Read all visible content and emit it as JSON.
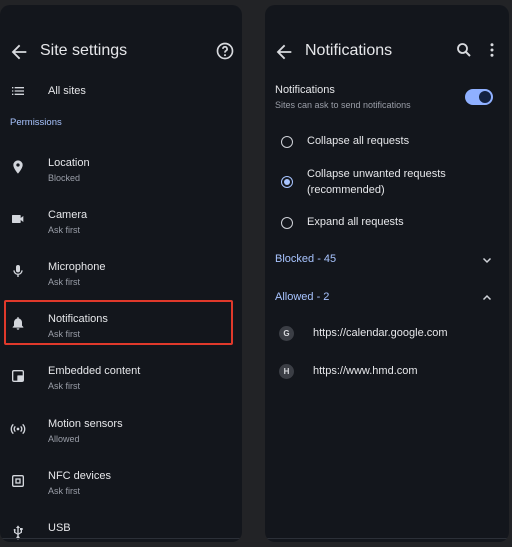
{
  "site_settings": {
    "title": "Site settings",
    "all_sites_label": "All sites",
    "section_label": "Permissions",
    "items": [
      {
        "label": "Location",
        "status": "Blocked"
      },
      {
        "label": "Camera",
        "status": "Ask first"
      },
      {
        "label": "Microphone",
        "status": "Ask first"
      },
      {
        "label": "Notifications",
        "status": "Ask first"
      },
      {
        "label": "Embedded content",
        "status": "Ask first"
      },
      {
        "label": "Motion sensors",
        "status": "Allowed"
      },
      {
        "label": "NFC devices",
        "status": "Ask first"
      },
      {
        "label": "USB",
        "status": ""
      }
    ]
  },
  "notifications": {
    "title": "Notifications",
    "toggle_label": "Notifications",
    "toggle_sub": "Sites can ask to send notifications",
    "toggle_on": true,
    "options": [
      {
        "label": "Collapse all requests",
        "selected": false
      },
      {
        "label": "Collapse unwanted requests (recommended)",
        "selected": true
      },
      {
        "label": "Expand all requests",
        "selected": false
      }
    ],
    "blocked_label": "Blocked - 45",
    "allowed_label": "Allowed - 2",
    "allowed_sites": [
      {
        "badge": "G",
        "url": "https://calendar.google.com"
      },
      {
        "badge": "H",
        "url": "https://www.hmd.com"
      }
    ]
  },
  "colors": {
    "accent": "#a8c4ff",
    "highlight": "#e0392b",
    "panel": "#13161c"
  }
}
